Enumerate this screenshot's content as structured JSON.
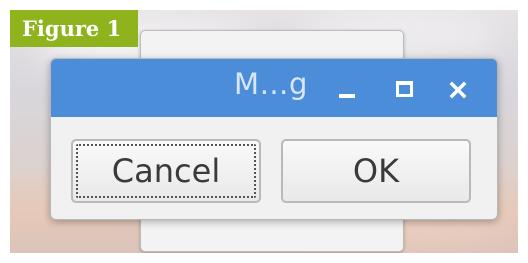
{
  "figure_label": "Figure 1",
  "dialog": {
    "title": "M…g",
    "buttons": {
      "cancel": "Cancel",
      "ok": "OK"
    }
  },
  "titlebar_icons": [
    "minimize-icon",
    "maximize-icon",
    "close-icon"
  ],
  "colors": {
    "titlebar": "#4b8dd8",
    "badge": "#8fb31c",
    "dialog_bg": "#f1f1f1",
    "button_text": "#3a3a3a"
  }
}
